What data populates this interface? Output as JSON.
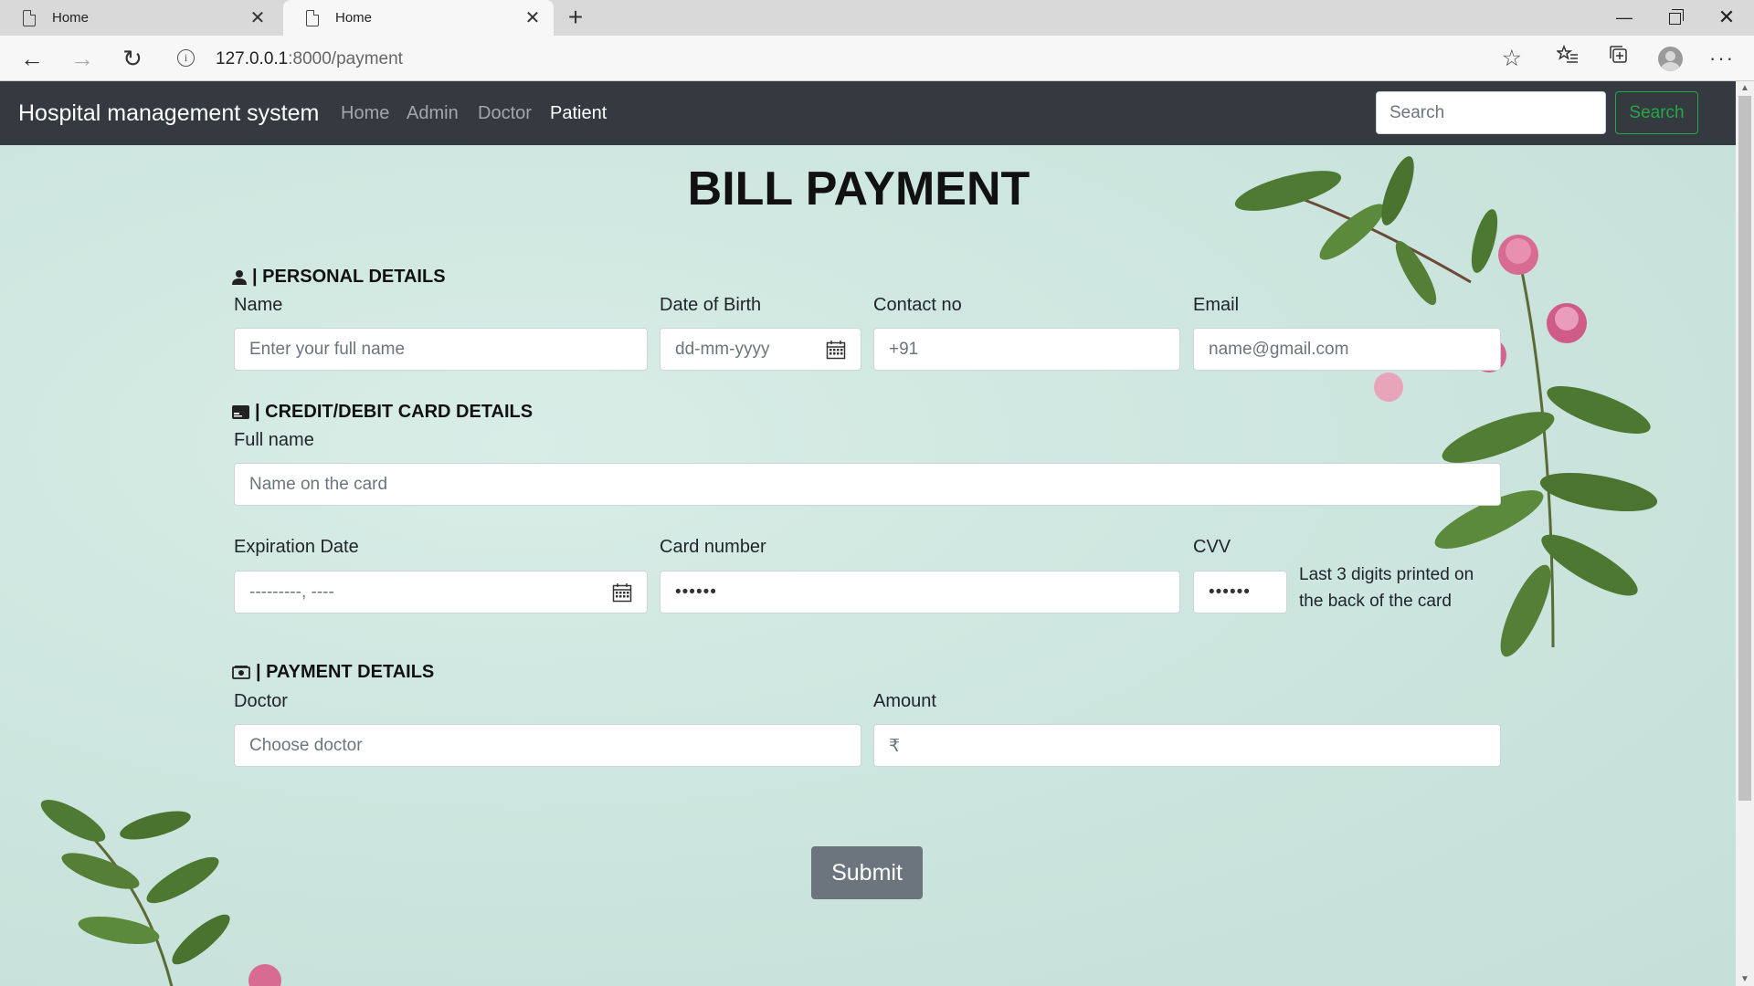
{
  "browser": {
    "tabs": [
      {
        "title": "Home",
        "active": false
      },
      {
        "title": "Home",
        "active": true
      }
    ],
    "url_host": "127.0.0.1",
    "url_path": ":8000/payment"
  },
  "navbar": {
    "brand": "Hospital management system",
    "links": {
      "home": "Home",
      "admin": "Admin",
      "doctor": "Doctor",
      "patient": "Patient"
    },
    "active_link": "Patient",
    "search_placeholder": "Search",
    "search_button": "Search"
  },
  "page": {
    "heading": "BILL PAYMENT",
    "personal": {
      "title": "| PERSONAL DETAILS",
      "name_label": "Name",
      "name_placeholder": "Enter your full name",
      "dob_label": "Date of Birth",
      "dob_placeholder": "dd-mm-yyyy",
      "contact_label": "Contact no",
      "contact_placeholder": "+91",
      "email_label": "Email",
      "email_placeholder": "name@gmail.com"
    },
    "card": {
      "title": "| CREDIT/DEBIT CARD DETAILS",
      "fullname_label": "Full name",
      "fullname_placeholder": "Name on the card",
      "exp_label": "Expiration Date",
      "exp_placeholder": "---------, ----",
      "number_label": "Card number",
      "number_value": "••••••",
      "cvv_label": "CVV",
      "cvv_value": "••••••",
      "cvv_note": "Last 3 digits printed on the back of the card"
    },
    "payment": {
      "title": "| PAYMENT DETAILS",
      "doctor_label": "Doctor",
      "doctor_placeholder": "Choose doctor",
      "amount_label": "Amount",
      "amount_placeholder": "₹"
    },
    "submit_label": "Submit"
  },
  "colors": {
    "navbar_bg": "#343a40",
    "search_button": "#28a745",
    "submit_bg": "#6c757d",
    "page_bg": "#cde6df"
  }
}
